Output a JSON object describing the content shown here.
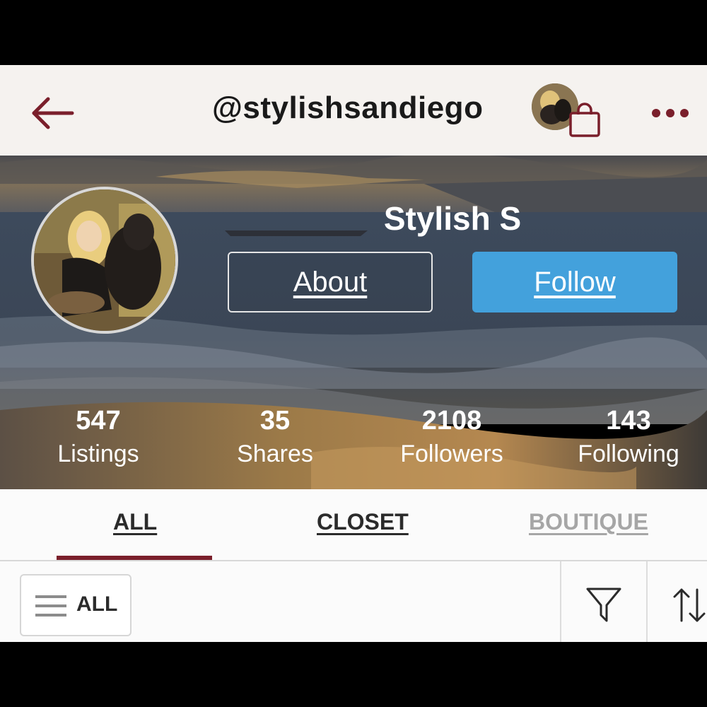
{
  "navbar": {
    "back_icon": "arrow-left-icon",
    "title": "@stylishsandiego",
    "avatar_icon": "user-avatar",
    "bag_icon": "shopping-bag-icon",
    "more_icon": "more-horizontal-icon"
  },
  "profile": {
    "name": "Stylish S",
    "about_label": "About",
    "follow_label": "Follow"
  },
  "stats": [
    {
      "value": "547",
      "label": "Listings"
    },
    {
      "value": "35",
      "label": "Shares"
    },
    {
      "value": "2108",
      "label": "Followers"
    },
    {
      "value": "143",
      "label": "Following"
    }
  ],
  "tabs": [
    {
      "label": "ALL",
      "active": true
    },
    {
      "label": "CLOSET",
      "active": false
    },
    {
      "label": "BOUTIQUE",
      "active": false
    }
  ],
  "filter_bar": {
    "dropdown_icon": "hamburger-menu-icon",
    "dropdown_label": "ALL",
    "filter_icon": "funnel-filter-icon",
    "sort_icon": "sort-arrows-icon"
  },
  "colors": {
    "brand": "#7a1f2b",
    "follow_button": "#43a1dc",
    "nav_background": "#f5f2ef",
    "inactive_tab": "#a6a6a6"
  }
}
